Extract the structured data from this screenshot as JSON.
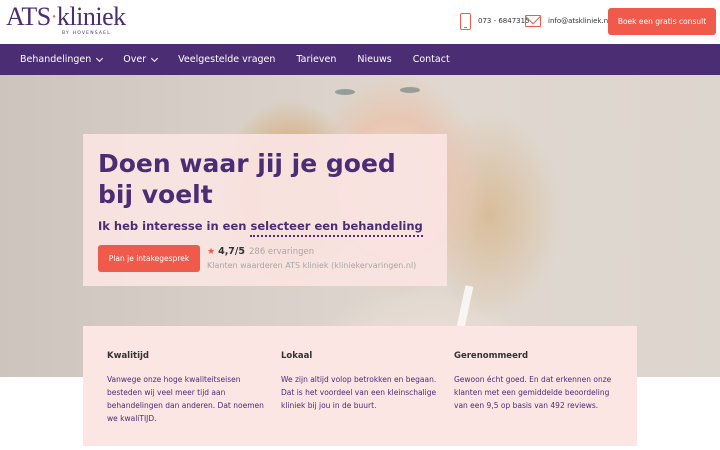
{
  "brand": {
    "logo_main": "ATS",
    "logo_second": "kliniek",
    "logo_sub": "BY HOVENSAEL"
  },
  "header": {
    "phone": "073 - 6847315",
    "email": "info@atskliniek.nl",
    "cta_label": "Boek een gratis consult"
  },
  "nav": {
    "items": [
      {
        "label": "Behandelingen",
        "dropdown": true
      },
      {
        "label": "Over",
        "dropdown": true
      },
      {
        "label": "Veelgestelde vragen",
        "dropdown": false
      },
      {
        "label": "Tarieven",
        "dropdown": false
      },
      {
        "label": "Nieuws",
        "dropdown": false
      },
      {
        "label": "Contact",
        "dropdown": false
      }
    ]
  },
  "hero": {
    "title": "Doen waar jij je goed bij voelt",
    "interest_prefix": "Ik heb interesse in een",
    "interest_select": "selecteer een behandeling",
    "button_label": "Plan je intakegesprek",
    "rating_score": "4,7/5",
    "rating_count": "286 ervaringen",
    "rating_source": "Klanten waarderen ATS kliniek (kliniekervaringen.nl)"
  },
  "usps": [
    {
      "title": "Kwalitijd",
      "text": "Vanwege onze hoge kwaliteitseisen besteden wij veel meer tijd aan behandelingen dan anderen. Dat noemen we kwaliTIJD."
    },
    {
      "title": "Lokaal",
      "text": "We zijn altijd volop betrokken en begaan. Dat is het voordeel van een kleinschalige kliniek bij jou in de buurt."
    },
    {
      "title": "Gerenommeerd",
      "text": "Gewoon écht goed. En dat erkennen onze klanten met een gemiddelde beoordeling van een 9,5 op basis van 492 reviews."
    }
  ],
  "colors": {
    "brand_purple": "#4b2d73",
    "accent_coral": "#f05a4a",
    "card_pink": "#fbe6e4"
  },
  "icons": {
    "phone": "phone-icon",
    "mail": "mail-icon",
    "star": "star-icon",
    "dropdown": "chevron-down-icon"
  }
}
